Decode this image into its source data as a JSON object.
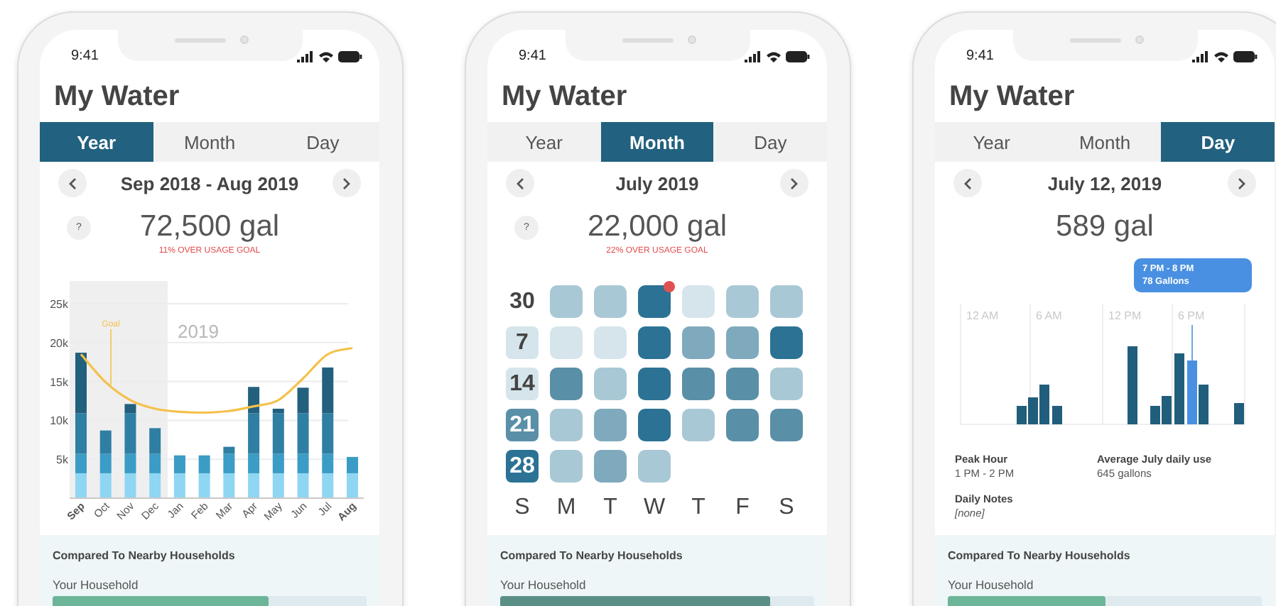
{
  "phones": [
    {
      "kind": "year",
      "status_time": "9:41",
      "title": "My Water",
      "tabs": [
        {
          "label": "Year",
          "selected": true
        },
        {
          "label": "Month",
          "selected": false
        },
        {
          "label": "Day",
          "selected": false
        }
      ],
      "period": "Sep 2018 - Aug 2019",
      "help": "?",
      "total": "72,500 gal",
      "goal_note": "11% OVER USAGE GOAL",
      "chart_data": {
        "type": "bar",
        "categories": [
          "Sep",
          "Oct",
          "Nov",
          "Dec",
          "Jan",
          "Feb",
          "Mar",
          "Apr",
          "May",
          "Jun",
          "Jul",
          "Aug"
        ],
        "series": [
          {
            "type": "bar",
            "color": "#8fd6f3",
            "values": [
              3200,
              3200,
              3200,
              3200,
              3200,
              3200,
              3200,
              3200,
              3200,
              3200,
              3200,
              3200
            ]
          },
          {
            "type": "bar",
            "color": "#3b9cc6",
            "values": [
              2500,
              2500,
              2500,
              2500,
              2300,
              2300,
              2500,
              2500,
              2500,
              2500,
              2500,
              2100
            ]
          },
          {
            "type": "bar",
            "color": "#2e7fa3",
            "values": [
              5200,
              3000,
              5200,
              3300,
              null,
              null,
              900,
              5200,
              5200,
              5200,
              5200,
              null
            ]
          },
          {
            "type": "bar",
            "color": "#22607e",
            "values": [
              7800,
              null,
              1200,
              null,
              null,
              null,
              null,
              3400,
              600,
              3300,
              5900,
              null
            ]
          },
          {
            "name": "Goal",
            "type": "line",
            "color": "#f5c04a",
            "values": [
              18500,
              14900,
              12600,
              11500,
              11100,
              11000,
              11200,
              11800,
              12600,
              15400,
              18500,
              19300
            ]
          }
        ],
        "stacked": true,
        "grid": true,
        "ylim": [
          0,
          25000
        ],
        "yticks": [
          {
            "value": 5000,
            "label": "5k"
          },
          {
            "value": 10000,
            "label": "10k"
          },
          {
            "value": 15000,
            "label": "15k"
          },
          {
            "value": 20000,
            "label": "20k"
          },
          {
            "value": 25000,
            "label": "25k"
          }
        ],
        "annotations": [
          "2019"
        ]
      },
      "comparison": {
        "title": "Compared To Nearby Households",
        "label": "Your Household",
        "level": 0.69,
        "color": "#6db598"
      }
    },
    {
      "kind": "month",
      "status_time": "9:41",
      "title": "My Water",
      "tabs": [
        {
          "label": "Year",
          "selected": false
        },
        {
          "label": "Month",
          "selected": true
        },
        {
          "label": "Day",
          "selected": false
        }
      ],
      "period": "July 2019",
      "help": "?",
      "total": "22,000 gal",
      "goal_note": "22% OVER USAGE GOAL",
      "calendar": {
        "weeks": [
          {
            "label": "30",
            "days": [
              {
                "color": "#a9c8d5",
                "alert": false
              },
              {
                "color": "#a9c8d5",
                "alert": false
              },
              {
                "color": "#2b7294",
                "alert": true
              },
              {
                "color": "#d5e5eb",
                "alert": false
              },
              {
                "color": "#a9c8d5",
                "alert": false
              },
              {
                "color": "#a9c8d5",
                "alert": false
              }
            ]
          },
          {
            "label": "7",
            "color": "#d5e5eb",
            "days": [
              {
                "color": "#d5e5eb",
                "alert": false
              },
              {
                "color": "#d5e5eb",
                "alert": false
              },
              {
                "color": "#2b7294",
                "alert": false
              },
              {
                "color": "#7faabd",
                "alert": false
              },
              {
                "color": "#7faabd",
                "alert": false
              },
              {
                "color": "#2b7294",
                "alert": false
              }
            ]
          },
          {
            "label": "14",
            "color": "#d5e5eb",
            "days": [
              {
                "color": "#5a8fa8",
                "alert": false
              },
              {
                "color": "#a9c8d5",
                "alert": false
              },
              {
                "color": "#2b7294",
                "alert": false
              },
              {
                "color": "#5a8fa8",
                "alert": false
              },
              {
                "color": "#5a8fa8",
                "alert": false
              },
              {
                "color": "#a9c8d5",
                "alert": false
              }
            ]
          },
          {
            "label": "21",
            "color": "#5a8fa8",
            "days": [
              {
                "color": "#a9c8d5",
                "alert": false
              },
              {
                "color": "#7faabd",
                "alert": false
              },
              {
                "color": "#2b7294",
                "alert": false
              },
              {
                "color": "#a9c8d5",
                "alert": false
              },
              {
                "color": "#5a8fa8",
                "alert": false
              },
              {
                "color": "#5a8fa8",
                "alert": false
              }
            ]
          },
          {
            "label": "28",
            "color": "#2b7294",
            "days": [
              {
                "color": "#a9c8d5",
                "alert": false
              },
              {
                "color": "#7faabd",
                "alert": false
              },
              {
                "color": "#a9c8d5",
                "alert": false
              }
            ]
          }
        ],
        "weekdays": [
          "S",
          "M",
          "T",
          "W",
          "T",
          "F",
          "S"
        ]
      },
      "comparison": {
        "title": "Compared To Nearby Households",
        "label": "Your Household",
        "level": 0.86,
        "color": "#5a8f86"
      }
    },
    {
      "kind": "day",
      "status_time": "9:41",
      "title": "My Water",
      "tabs": [
        {
          "label": "Year",
          "selected": false
        },
        {
          "label": "Month",
          "selected": false
        },
        {
          "label": "Day",
          "selected": true
        }
      ],
      "period": "July 12, 2019",
      "total": "589 gal",
      "hour_labels": [
        "12 AM",
        "6 AM",
        "12 PM",
        "6 PM"
      ],
      "tooltip": {
        "time": "7 PM - 8 PM",
        "amount": "78 Gallons"
      },
      "stats": [
        {
          "label": "Peak Hour",
          "value": "1 PM - 2 PM"
        },
        {
          "label": "Average July daily use",
          "value": "645 gallons"
        }
      ],
      "notes": {
        "label": "Daily Notes",
        "value": "[none]"
      },
      "comparison": {
        "title": "Compared To Nearby Households",
        "label": "Your Household",
        "level": 0.5,
        "color": "#6db598"
      }
    }
  ]
}
